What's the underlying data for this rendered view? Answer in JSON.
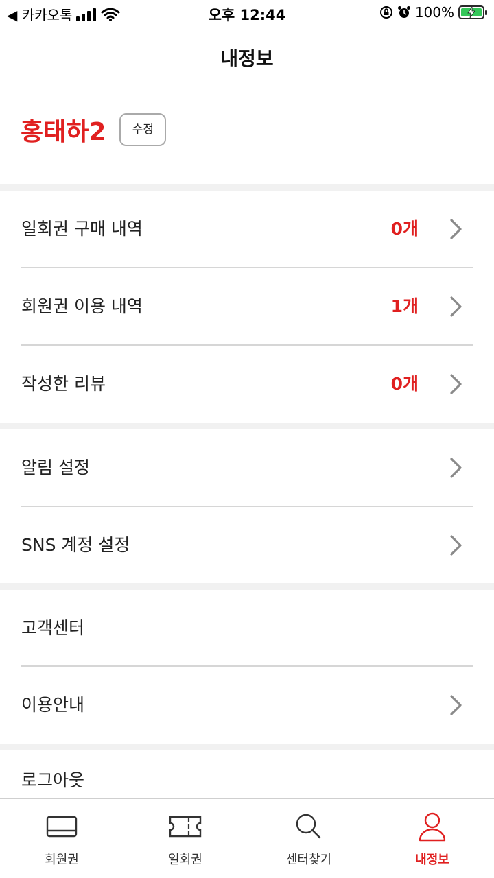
{
  "status_bar": {
    "carrier": "◀ 카카오톡",
    "time": "오후 12:44",
    "battery": "100%"
  },
  "nav": {
    "title": "내정보"
  },
  "profile": {
    "name": "홍태하2",
    "edit_label": "수정"
  },
  "menu": {
    "history": [
      {
        "label": "일회권 구매 내역",
        "count": "0개"
      },
      {
        "label": "회원권 이용 내역",
        "count": "1개"
      },
      {
        "label": "작성한 리뷰",
        "count": "0개"
      }
    ],
    "settings": [
      {
        "label": "알림 설정"
      },
      {
        "label": "SNS 계정 설정"
      }
    ],
    "support": [
      {
        "label": "고객센터"
      },
      {
        "label": "이용안내"
      }
    ],
    "logout_label": "로그아웃"
  },
  "tab_bar": {
    "tabs": [
      {
        "label": "회원권",
        "icon": "membership-card-icon"
      },
      {
        "label": "일회권",
        "icon": "ticket-icon"
      },
      {
        "label": "센터찾기",
        "icon": "search-icon"
      },
      {
        "label": "내정보",
        "icon": "person-icon"
      }
    ],
    "active_index": 3
  },
  "colors": {
    "accent": "#e02020",
    "divider": "#d6d6d6",
    "section_gap": "#f1f1f1"
  }
}
